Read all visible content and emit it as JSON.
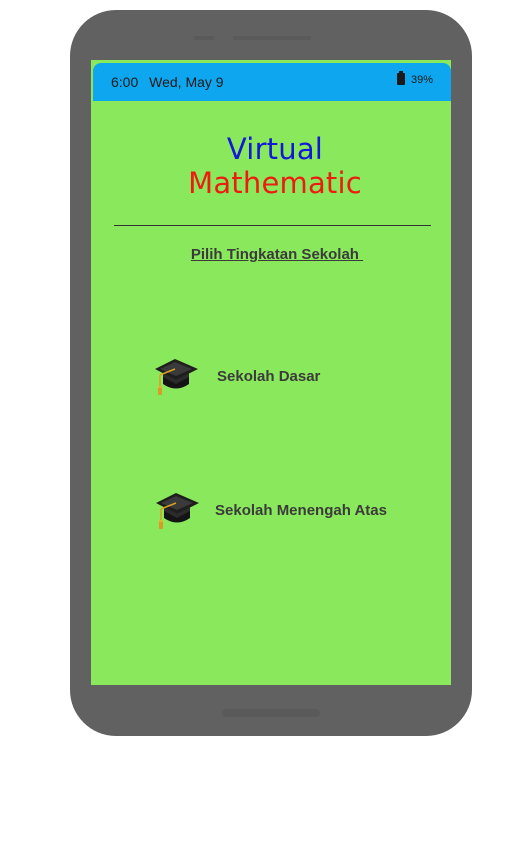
{
  "status_bar": {
    "time": "6:00",
    "date": "Wed, May 9",
    "battery": "39%"
  },
  "app": {
    "title_line1": "Virtual",
    "title_line2": "Mathematic",
    "subtitle": "Pilih Tingkatan Sekolah "
  },
  "options": [
    {
      "label": "Sekolah Dasar",
      "icon": "graduation-cap-icon"
    },
    {
      "label": "Sekolah Menengah Atas",
      "icon": "graduation-cap-icon"
    }
  ],
  "colors": {
    "screen_background": "#8ae85c",
    "status_bar": "#0ea6ee",
    "title_blue": "#1218d8",
    "title_red": "#ee1c10",
    "phone_body": "#616161"
  }
}
